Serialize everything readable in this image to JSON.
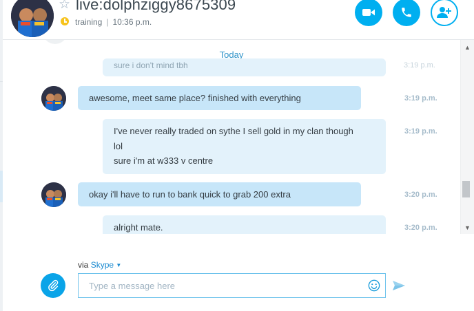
{
  "contact": {
    "name": "live:dolphziggy8675309",
    "mood": "training",
    "local_time": "10:36 p.m."
  },
  "header_actions": {
    "video_call": "video-call",
    "audio_call": "audio-call",
    "add_people": "add-people"
  },
  "conversation": {
    "date_divider": "Today",
    "partial_message": {
      "text": "sure i don't mind tbh",
      "time": "3:19 p.m."
    },
    "messages": [
      {
        "direction": "incoming",
        "lines": [
          "awesome, meet same place? finished with everything"
        ],
        "time": "3:19 p.m."
      },
      {
        "direction": "outgoing",
        "lines": [
          "I've never really traded on sythe I sell gold in my clan though",
          "lol",
          "sure i'm at w333 v centre"
        ],
        "time": "3:19 p.m."
      },
      {
        "direction": "incoming",
        "lines": [
          "okay i'll have to run to bank quick to grab 200 extra"
        ],
        "time": "3:20 p.m."
      },
      {
        "direction": "outgoing",
        "lines": [
          "alright mate."
        ],
        "time": "3:20 p.m."
      }
    ]
  },
  "compose": {
    "via_prefix": "via",
    "via_service": "Skype",
    "placeholder": "Type a message here",
    "attach_icon": "paperclip-icon",
    "emoji_icon": "smiley-icon",
    "send_icon": "send-icon"
  },
  "colors": {
    "accent": "#00aff0",
    "incoming_bubble": "#c7e6f9",
    "outgoing_bubble": "#e3f2fb",
    "timestamp": "#a6bccb",
    "status": "#f7c31d"
  }
}
